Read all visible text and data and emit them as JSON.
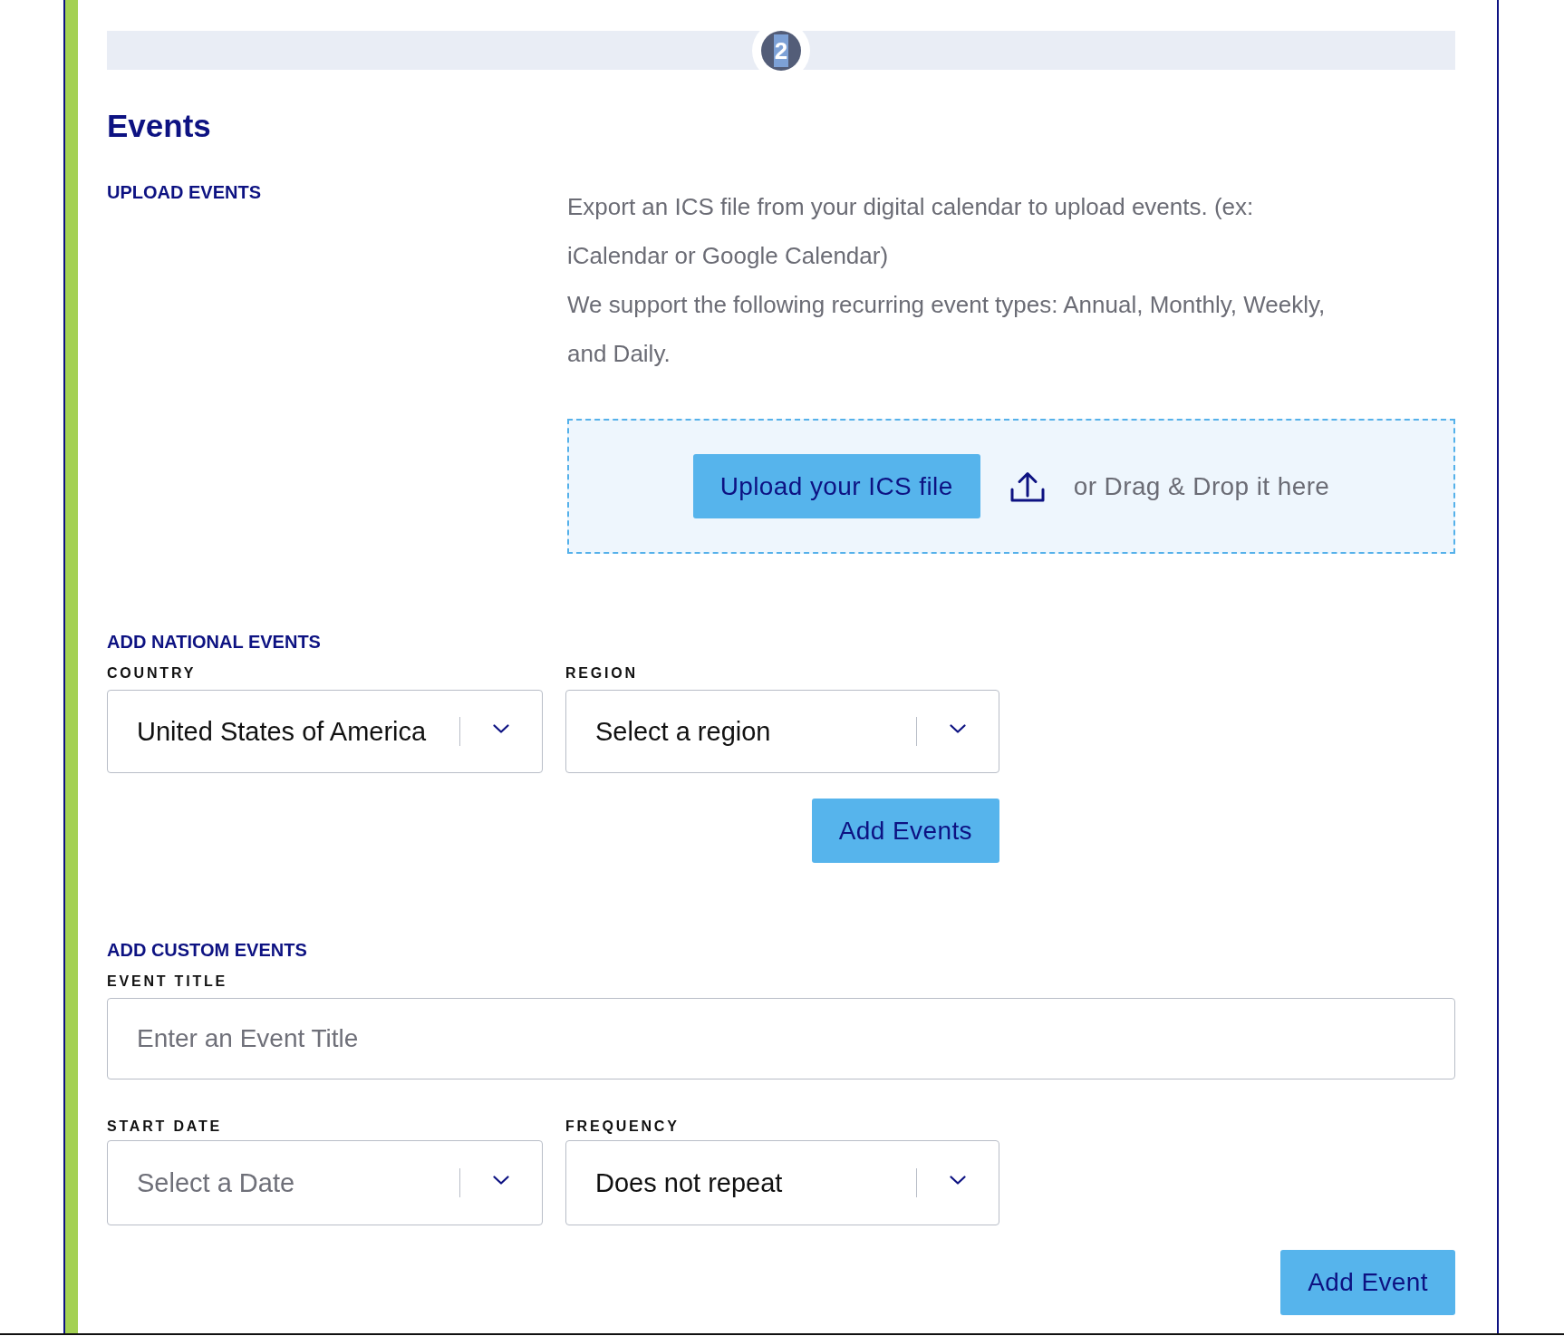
{
  "step": {
    "number": "2",
    "text_selected": true
  },
  "section": {
    "title": "Events"
  },
  "upload": {
    "heading": "UPLOAD EVENTS",
    "description": [
      "Export an ICS file from your digital calendar to upload events. (ex: iCalendar or Google Calendar)",
      "We support the following recurring event types: Annual, Monthly, Weekly, and Daily."
    ],
    "button": "Upload your ICS file",
    "drop_hint": "or Drag & Drop it here"
  },
  "national": {
    "heading": "ADD NATIONAL EVENTS",
    "fields": [
      {
        "label": "COUNTRY",
        "value": "United States of America"
      },
      {
        "label": "REGION",
        "value": "Select a region"
      }
    ],
    "button": "Add Events"
  },
  "custom": {
    "heading": "ADD CUSTOM EVENTS",
    "title_field": {
      "label": "EVENT TITLE",
      "placeholder": "Enter an Event Title"
    },
    "fields": [
      {
        "label": "START DATE",
        "placeholder": "Select a Date"
      },
      {
        "label": "FREQUENCY",
        "value": "Does not repeat"
      }
    ],
    "button": "Add Event"
  }
}
